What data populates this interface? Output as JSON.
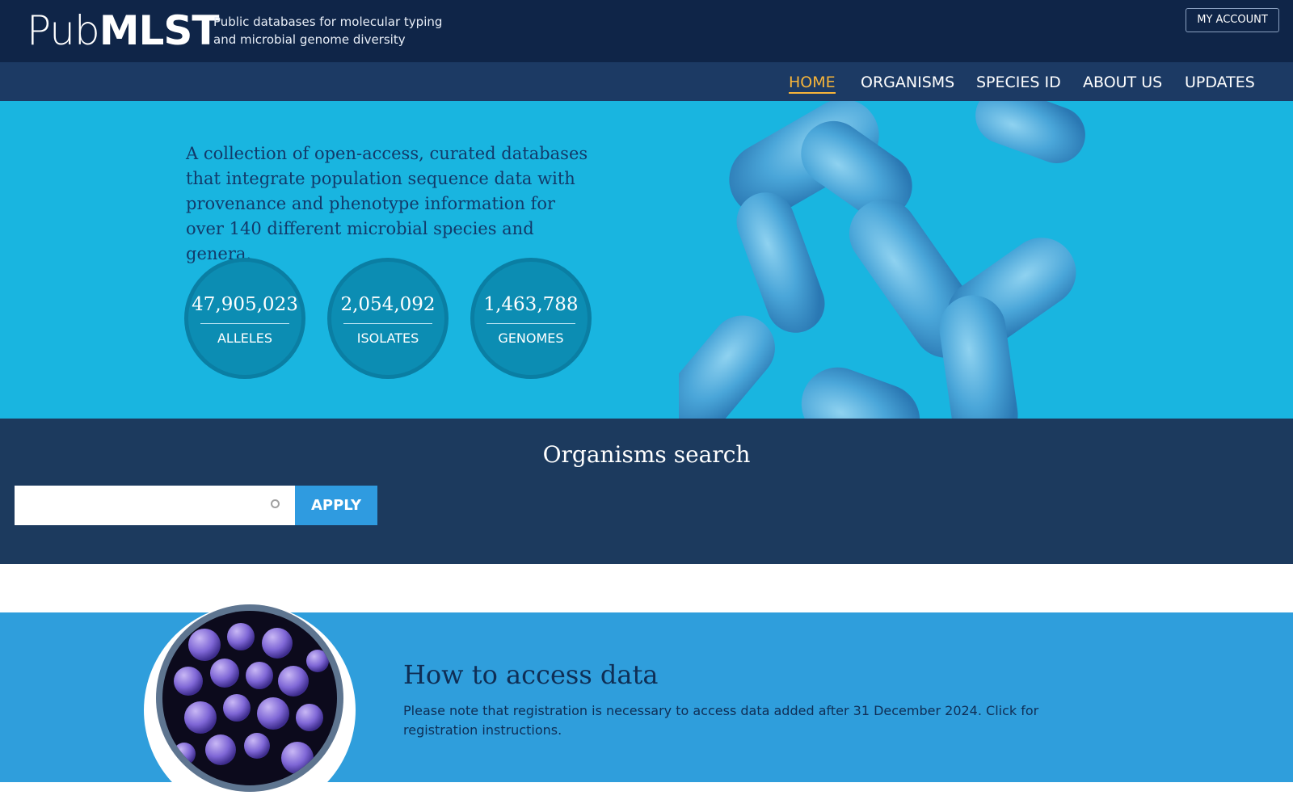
{
  "header": {
    "logo_pub": "Pub",
    "logo_mlst": "MLST",
    "tagline_line1": "Public databases for molecular typing",
    "tagline_line2": "and microbial genome diversity",
    "account_label": "MY ACCOUNT"
  },
  "nav": {
    "items": [
      {
        "label": "HOME",
        "active": true
      },
      {
        "label": "ORGANISMS",
        "active": false
      },
      {
        "label": "SPECIES ID",
        "active": false
      },
      {
        "label": "ABOUT US",
        "active": false
      },
      {
        "label": "UPDATES",
        "active": false
      }
    ]
  },
  "hero": {
    "description": "A collection of open-access, curated databases that integrate population sequence data with provenance and phenotype information for over 140 different microbial species and genera.",
    "stats": [
      {
        "value": "47,905,023",
        "label": "ALLELES"
      },
      {
        "value": "2,054,092",
        "label": "ISOLATES"
      },
      {
        "value": "1,463,788",
        "label": "GENOMES"
      }
    ]
  },
  "search": {
    "title": "Organisms search",
    "input_value": "",
    "placeholder": "",
    "apply_label": "APPLY"
  },
  "access": {
    "title": "How to access data",
    "text": "Please note that registration is necessary to access data added after 31 December 2024. Click for registration instructions."
  },
  "colors": {
    "header_bg": "#0f2548",
    "nav_bg": "#1c3a64",
    "nav_active": "#f6b43a",
    "hero_bg": "#19b5e0",
    "stat_circle": "#0c8db3",
    "search_bg": "#1c3a5e",
    "apply_btn": "#2f9be0",
    "access_bg": "#2f9edc"
  }
}
